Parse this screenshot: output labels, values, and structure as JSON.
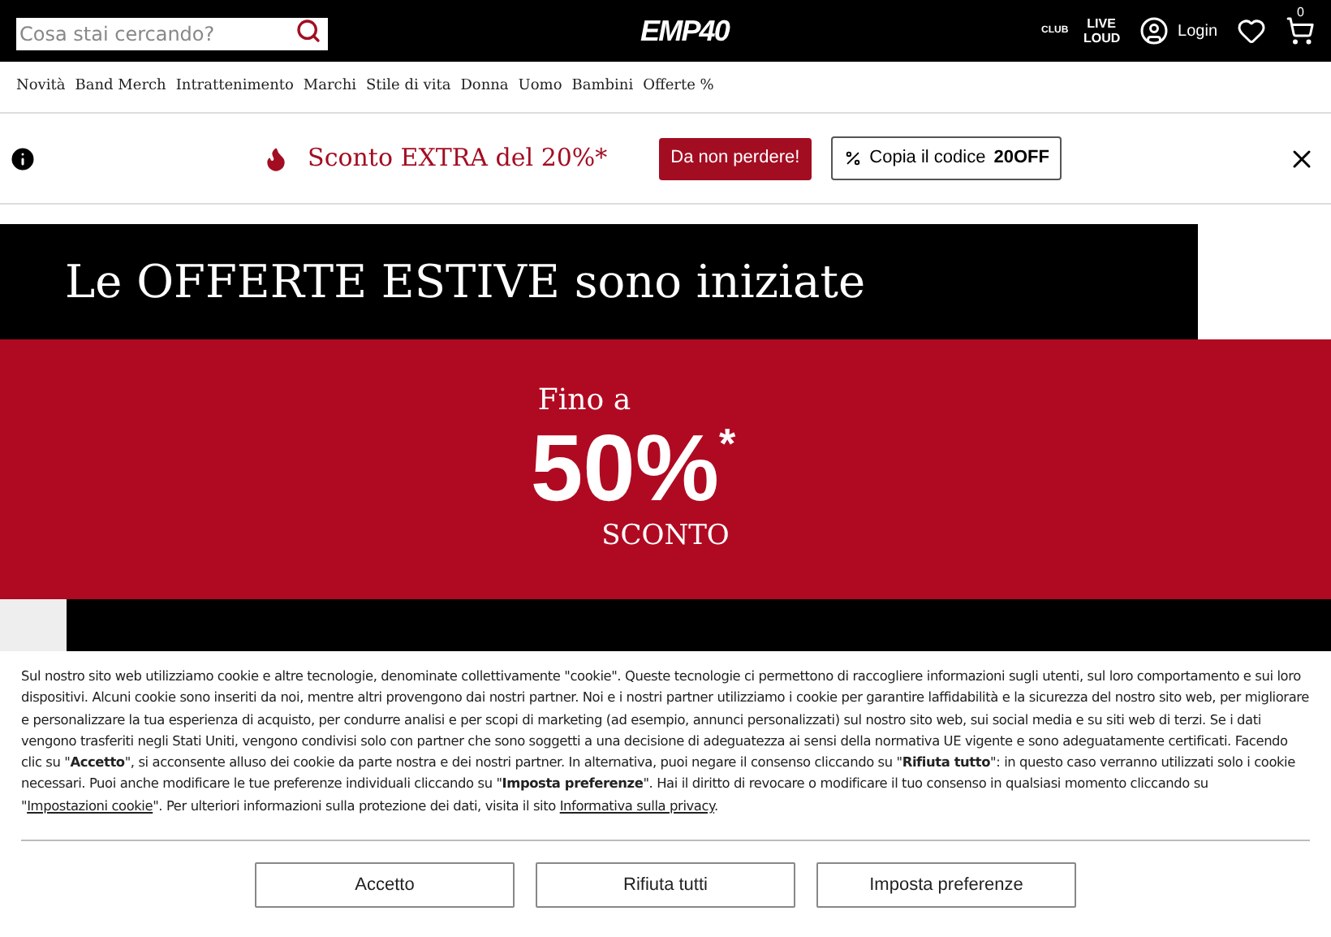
{
  "header": {
    "search": {
      "placeholder": "Cosa stai cercando?"
    },
    "logo": "EMP40",
    "club": "CLUB",
    "live_loud": "LIVE LOUD",
    "login": "Login",
    "cart_count": "0"
  },
  "nav": [
    "Novità",
    "Band Merch",
    "Intrattenimento",
    "Marchi",
    "Stile di vita",
    "Donna",
    "Uomo",
    "Bambini",
    "Offerte %"
  ],
  "promo": {
    "text": "Sconto EXTRA del 20%*",
    "cta": "Da non perdere!",
    "copy_label": "Copia il codice ",
    "code": "20OFF"
  },
  "hero": {
    "headline": "Le OFFERTE ESTIVE sono iniziate",
    "upto": "Fino a",
    "percent": "50%",
    "asterisk": "*",
    "discount": "SCONTO"
  },
  "cookie": {
    "segments": [
      {
        "kind": "text",
        "text": "Sul nostro sito web utilizziamo cookie e altre tecnologie, denominate collettivamente \"cookie\". Queste tecnologie ci permettono di raccogliere informazioni sugli utenti, sul loro comportamento e sui loro dispositivi. Alcuni cookie sono inseriti da noi, mentre altri provengono dai nostri partner. Noi e i nostri partner utilizziamo i cookie per garantire laffidabilità e la sicurezza del nostro sito web, per migliorare e personalizzare la tua esperienza di acquisto, per condurre analisi e per scopi di marketing (ad esempio, annunci personalizzati) sul nostro sito web, sui social media e su siti web di terzi. Se i dati vengono trasferiti negli Stati Uniti, vengono condivisi solo con partner che sono soggetti a una decisione di adeguatezza ai sensi della normativa UE vigente e sono adeguatamente certificati. Facendo clic su \"**Accetto**\", si acconsente alluso dei cookie da parte nostra e dei nostri partner. In alternativa, puoi negare il consenso cliccando su \"**Rifiuta tutto**\": in questo caso verranno utilizzati solo i cookie necessari. Puoi anche modificare le tue preferenze individuali cliccando su \"**Imposta preferenze**\". Hai il diritto di revocare o modificare il tuo consenso in qualsiasi momento cliccando su \""
      },
      {
        "kind": "link",
        "text": "Impostazioni cookie"
      },
      {
        "kind": "text",
        "text": "\". Per ulteriori informazioni sulla protezione dei dati, visita il sito "
      },
      {
        "kind": "link",
        "text": "Informativa sulla privacy"
      },
      {
        "kind": "text",
        "text": "."
      }
    ],
    "buttons": [
      "Accetto",
      "Rifiuta tutti",
      "Imposta preferenze"
    ]
  }
}
